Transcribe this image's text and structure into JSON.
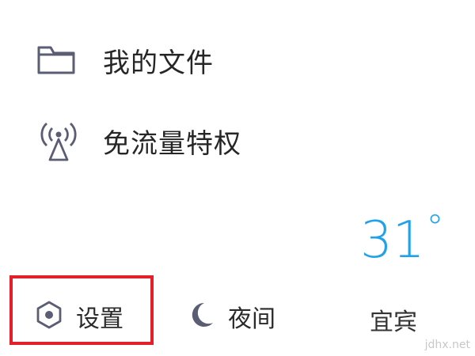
{
  "menu": {
    "files_label": "我的文件",
    "traffic_label": "免流量特权"
  },
  "weather": {
    "temperature": "31",
    "degree_symbol": "°",
    "city": "宜宾"
  },
  "bottom_bar": {
    "settings_label": "设置",
    "night_label": "夜间"
  },
  "watermark": "jdhx.net",
  "colors": {
    "accent_blue": "#1fa2e8",
    "highlight_red": "#e3202a",
    "icon_gray": "#5a5d73"
  }
}
